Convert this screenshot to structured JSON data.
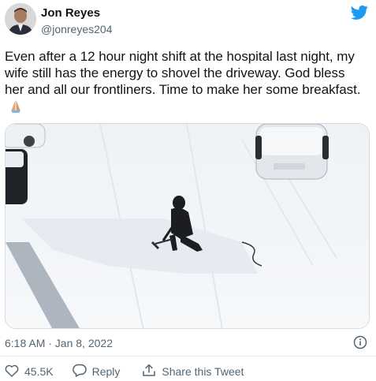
{
  "author": {
    "name": "Jon Reyes",
    "handle": "@jonreyes204"
  },
  "tweet": {
    "text": "Even after a 12 hour night shift at the hospital last night, my wife still has the energy to shovel the driveway. God bless her and all our frontliners. Time to make her some breakfast.",
    "emoji": "folded-hands-emoji"
  },
  "timestamp": "6:18 AM · Jan 8, 2022",
  "actions": {
    "like_count": "45.5K",
    "reply_label": "Reply",
    "share_label": "Share this Tweet"
  },
  "icons": [
    "twitter-bird-icon",
    "info-icon",
    "heart-icon",
    "reply-icon",
    "share-icon"
  ],
  "colors": {
    "brand": "#1d9bf0",
    "text": "#0f1419",
    "secondary": "#536471",
    "divider": "#e6ecf0"
  }
}
